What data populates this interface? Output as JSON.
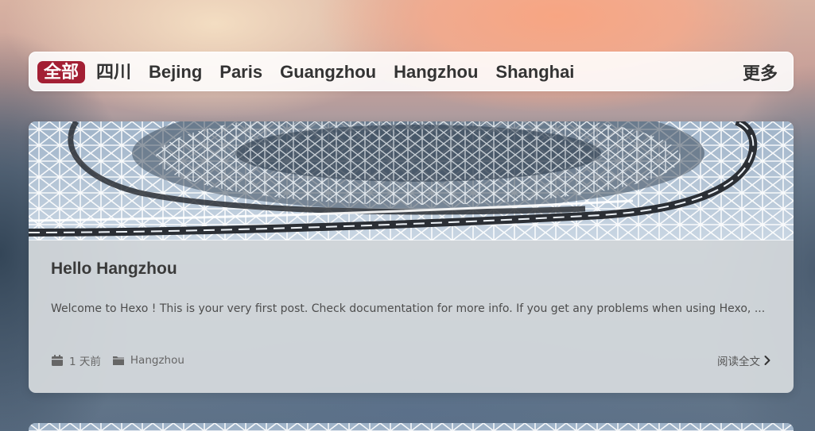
{
  "nav": {
    "items": [
      {
        "label": "全部",
        "active": true
      },
      {
        "label": "四川",
        "active": false
      },
      {
        "label": "Bejing",
        "active": false
      },
      {
        "label": "Paris",
        "active": false
      },
      {
        "label": "Guangzhou",
        "active": false
      },
      {
        "label": "Hangzhou",
        "active": false
      },
      {
        "label": "Shanghai",
        "active": false
      }
    ],
    "more_label": "更多"
  },
  "post": {
    "title": "Hello Hangzhou",
    "excerpt": "Welcome to Hexo ! This is your very first post. Check documentation for more info. If you get any problems when using Hexo, ...",
    "date": "1 天前",
    "category": "Hangzhou",
    "read_more": "阅读全文",
    "date_icon": "calendar-icon",
    "category_icon": "folder-icon",
    "read_more_icon": "chevron-right-icon"
  },
  "colors": {
    "accent": "#a31f34",
    "nav_text": "#333333"
  }
}
